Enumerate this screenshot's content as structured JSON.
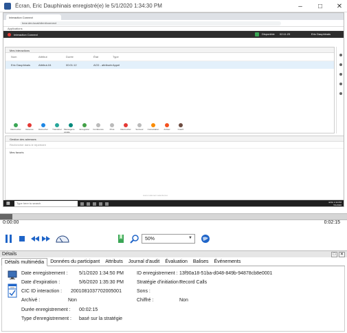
{
  "window": {
    "title": "Écran, Eric Dauphinais enregistré(e) le 5/1/2020 1:34:30 PM"
  },
  "recording": {
    "browser_tab": "Interaction Connect",
    "url": "hear.dev.local/client/connect",
    "bookmarks": "Applications",
    "app_title": "Interaction Connect",
    "status": "Disponible",
    "time": "02:11:23",
    "user": "Eric Dauphinais",
    "panel1_tab": "Mes interactions",
    "columns": [
      "Nom",
      "Attribut",
      "Durée",
      "État",
      "Type"
    ],
    "row": [
      "Eric Dauphinais",
      "Attribut-04",
      "00:01:12",
      "ACD - attribuée",
      "Appel"
    ],
    "actions": [
      "Raccrocher",
      "Retenue",
      "Décrocher",
      "Transférer",
      "Messagerie vocale",
      "Enregistrer",
      "Conférence",
      "Privé",
      "Raccrocher",
      "Sonneur",
      "Consultation",
      "Activer",
      "Coach"
    ],
    "panel2_tab": "Gestion des adresses",
    "search_placeholder": "Rechercher dans le répertoire",
    "tree_node": "Mes favoris",
    "empty_msg": "Aucun élément sélectionné",
    "taskbar_search": "Type here to search",
    "clock": "1:34 PM",
    "date": "5/1/2020",
    "lang": "ENG"
  },
  "player": {
    "time_current": "0:00:00",
    "time_total": "0:02:15",
    "zoom": "50%"
  },
  "details": {
    "header": "Détails",
    "tabs": [
      "Détails multimédia",
      "Données du participant",
      "Attributs",
      "Journal d'audit",
      "Évaluation",
      "Balises",
      "Événements"
    ],
    "fields": {
      "date_rec_label": "Date enregistrement :",
      "date_rec_value": "5/1/2020 1:34:50 PM",
      "date_exp_label": "Date d'expiration :",
      "date_exp_value": "5/6/2020 1:35:30 PM",
      "cic_label": "CIC ID interaction :",
      "cic_value": "2001081037702005001",
      "archive_label": "Archivé :",
      "archive_value": "Non",
      "duree_label": "Durée enregistrement :",
      "duree_value": "00:02:15",
      "type_label": "Type d'enregistrement :",
      "type_value": "basé sur la stratégie",
      "id_label": "ID enregistrement :",
      "id_value": "13f90a18-51ba-d048-849b-94878cb8e0001",
      "strat_label": "Stratégie d'initiation :",
      "strat_value": "Record Calls",
      "sons_label": "Sons :",
      "sons_value": "",
      "chiffre_label": "Chiffré :",
      "chiffre_value": "Non"
    }
  }
}
